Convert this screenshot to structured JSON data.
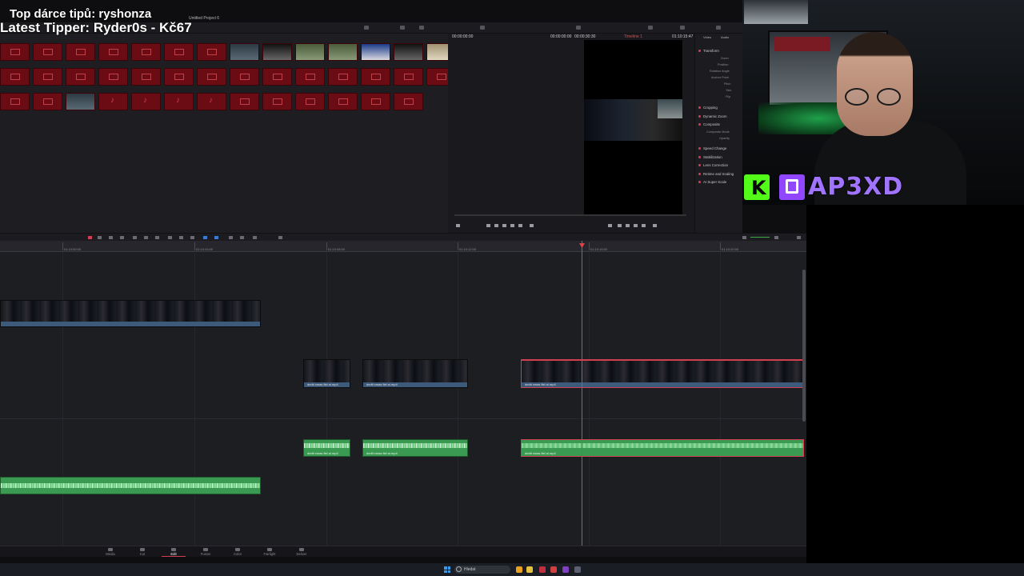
{
  "overlay": {
    "top_donor": "Top dárce tipů: ryshonza",
    "latest_tipper": "Latest Tipper: Ryder0s - Kč67"
  },
  "app": {
    "project_title": "Untitled Project 6"
  },
  "viewer": {
    "source_tc": "00:00:00:00",
    "duration_tc": "00:00:00:00",
    "zoom_tc": "00:00:30:30",
    "timeline_name": "Timeline 1",
    "timeline_tc": "01:10:15:47"
  },
  "inspector": {
    "tabs": [
      "Video",
      "Audio"
    ],
    "sections": [
      "Transform",
      "Cropping",
      "Dynamic Zoom",
      "Composite",
      "Speed Change",
      "Stabilization",
      "Lens Correction",
      "Retime and Scaling",
      "AI Super Scale"
    ],
    "transform_fields": [
      "Zoom",
      "Position",
      "Rotation Angle",
      "Anchor Point",
      "Pitch",
      "Yaw",
      "Flip"
    ],
    "composite_fields": [
      "Composite Mode",
      "Opacity"
    ]
  },
  "streamer": {
    "name": "AP3XD"
  },
  "timeline": {
    "ruler_labels": [
      "01:10:00:00",
      "01:10:04:00",
      "01:10:08:00",
      "01:10:12:00",
      "01:10:16:00",
      "01:10:20:00"
    ],
    "clips": [
      {
        "label": "dedit xmas fiel ai.mp4"
      },
      {
        "label": "dedit xmas fiel ai.mp4"
      },
      {
        "label": "dedit xmas fiel ai.mp4"
      }
    ],
    "audio_clips": [
      {
        "label": "dedit xmas fiel ai.mp4"
      },
      {
        "label": "dedit xmas fiel ai.mp4"
      },
      {
        "label": "dedit xmas fiel ai.mp4"
      }
    ]
  },
  "pages": [
    {
      "label": "Media"
    },
    {
      "label": "Cut"
    },
    {
      "label": "Edit"
    },
    {
      "label": "Fusion"
    },
    {
      "label": "Color"
    },
    {
      "label": "Fairlight"
    },
    {
      "label": "Deliver"
    }
  ],
  "taskbar": {
    "search_placeholder": "Hledat"
  },
  "colors": {
    "accent": "#d04050",
    "audio_clip": "#3b9a52",
    "video_clip": "#3e5a7a",
    "kick": "#53fc18",
    "twitch": "#9146ff"
  },
  "icons": [
    "windows-icon",
    "search-icon",
    "music-note-icon",
    "kick-icon",
    "twitch-icon",
    "playhead-icon"
  ]
}
